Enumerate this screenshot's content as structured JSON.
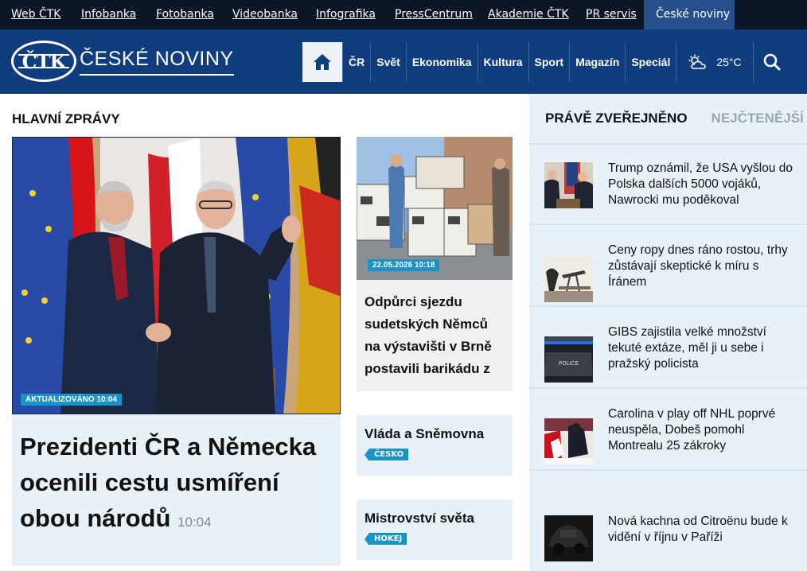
{
  "topbar": {
    "links": [
      "Web ČTK",
      "Infobanka",
      "Fotobanka",
      "Videobanka",
      "Infografika",
      "PressCentrum",
      "Akademie ČTK",
      "PR servis"
    ],
    "active": "České noviny"
  },
  "header": {
    "logo_mark": "ČTK",
    "logo_text": "ČESKÉ NOVINY",
    "nav": [
      "ČR",
      "Svět",
      "Ekonomika",
      "Kultura",
      "Sport",
      "Magazín",
      "Speciál"
    ],
    "temperature": "25°C"
  },
  "main": {
    "section_title": "HLAVNÍ ZPRÁVY",
    "lead": {
      "badge": "AKTUALIZOVÁNO 10:04",
      "title": "Prezidenti ČR a Německa ocenili cestu usmíření obou národů",
      "time": "10:04"
    },
    "second": {
      "badge": "22.05.2026 10:18",
      "title": "Odpůrci sjezdu sudetských Němců na výstavišti v Brně postavili barikádu z"
    },
    "minis": [
      {
        "title": "Vláda a Sněmovna",
        "tag": "ČESKO"
      },
      {
        "title": "Mistrovství světa",
        "tag": "HOKEJ"
      }
    ]
  },
  "sidebar": {
    "tab_active": "PRÁVĚ ZVEŘEJNĚNO",
    "tab_inactive": "NEJČTENĚJŠÍ",
    "items": [
      {
        "text": "Trump oznámil, že USA vyšlou do Polska dalších 5000 vojáků, Nawrocki mu poděkoval"
      },
      {
        "text": "Ceny ropy dnes ráno rostou, trhy zůstávají skeptické k míru s Íránem"
      },
      {
        "text": "GIBS zajistila velké množství tekuté extáze, měl ji u sebe i pražský policista"
      },
      {
        "text": "Carolina v play off NHL poprvé neuspěla, Dobeš pomohl Montrealu 25 zákroky"
      },
      {
        "text": "Nová kachna od Citroënu bude k vidění v říjnu v Paříži"
      }
    ]
  },
  "colors": {
    "topbar": "#0d1626",
    "header": "#0f3d7d",
    "accent": "#1a93c7",
    "light": "#e7f1f7"
  }
}
